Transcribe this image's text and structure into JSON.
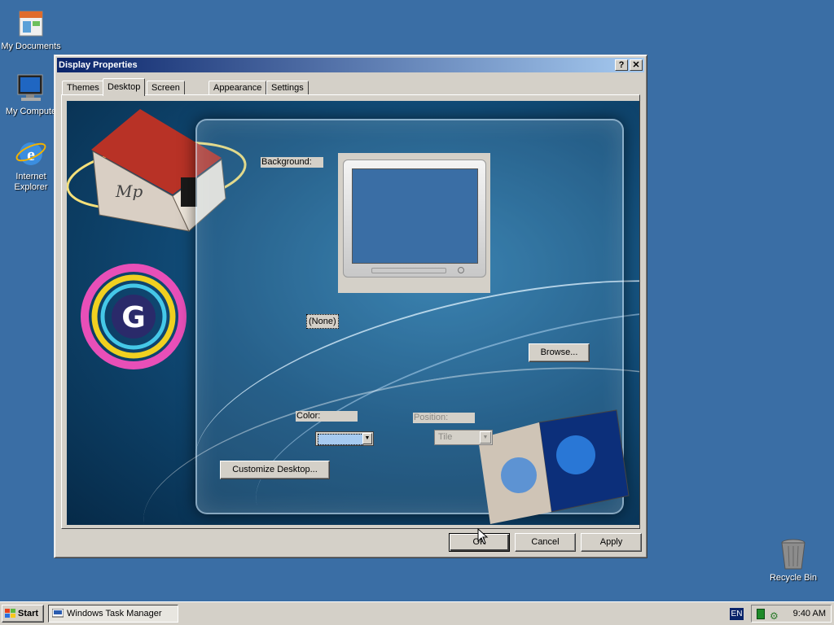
{
  "desktop": {
    "icons": [
      {
        "label": "My Documents"
      },
      {
        "label": "My Compute"
      },
      {
        "label": "Internet Explorer"
      },
      {
        "label": "Recycle Bin"
      }
    ]
  },
  "dialog": {
    "title": "Display Properties",
    "help_glyph": "?",
    "close_glyph": "✕",
    "tabs": [
      {
        "label": "Themes"
      },
      {
        "label": "Desktop",
        "active": true
      },
      {
        "label": "Screen Saver"
      },
      {
        "label": "Appearance"
      },
      {
        "label": "Settings"
      }
    ],
    "background_label": "Background:",
    "background_selected": "(None)",
    "browse_label": "Browse...",
    "color_label": "Color:",
    "color_value": "#a6caf0",
    "position_label": "Position:",
    "position_value": "Tile",
    "customize_label": "Customize Desktop...",
    "ok_label": "OK",
    "cancel_label": "Cancel",
    "apply_label": "Apply"
  },
  "taskbar": {
    "start_label": "Start",
    "tasks": [
      {
        "label": "Windows Task Manager"
      }
    ],
    "language": "EN",
    "clock": "9:40 AM"
  },
  "colors": {
    "desktop": "#3a6ea5",
    "title_start": "#0a246a",
    "title_end": "#a6caf0",
    "face": "#d4d0c8"
  }
}
